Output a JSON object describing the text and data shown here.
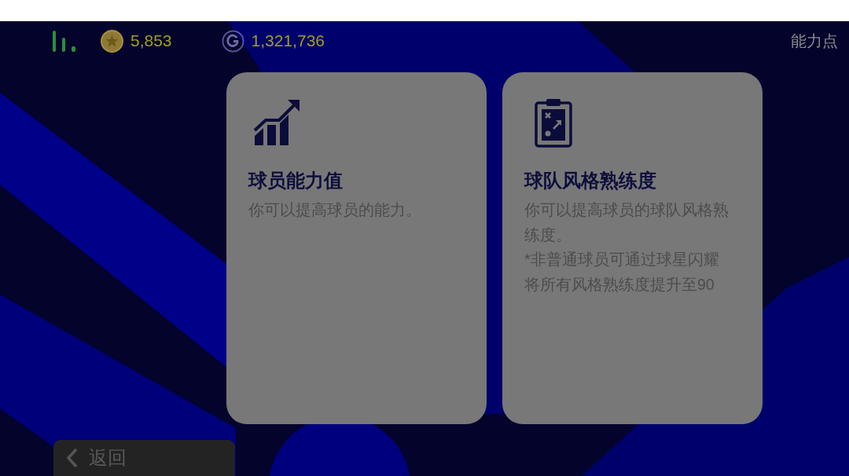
{
  "top_bar": {
    "currencies": [
      {
        "kind": "star_coin",
        "amount": "5,853"
      },
      {
        "kind": "g_coin",
        "amount": "1,321,736"
      }
    ],
    "page_title": "能力点"
  },
  "cards": [
    {
      "kind": "chart",
      "title": "球员能力值",
      "description": [
        "你可以提高球员的能力。"
      ]
    },
    {
      "kind": "clipboard",
      "title": "球队风格熟练度",
      "description": [
        "你可以提高球员的球队风格熟练度。",
        "*非普通球员可通过球星闪耀将所有风格熟练度提升至90"
      ]
    }
  ],
  "back_button": {
    "label": "返回"
  }
}
